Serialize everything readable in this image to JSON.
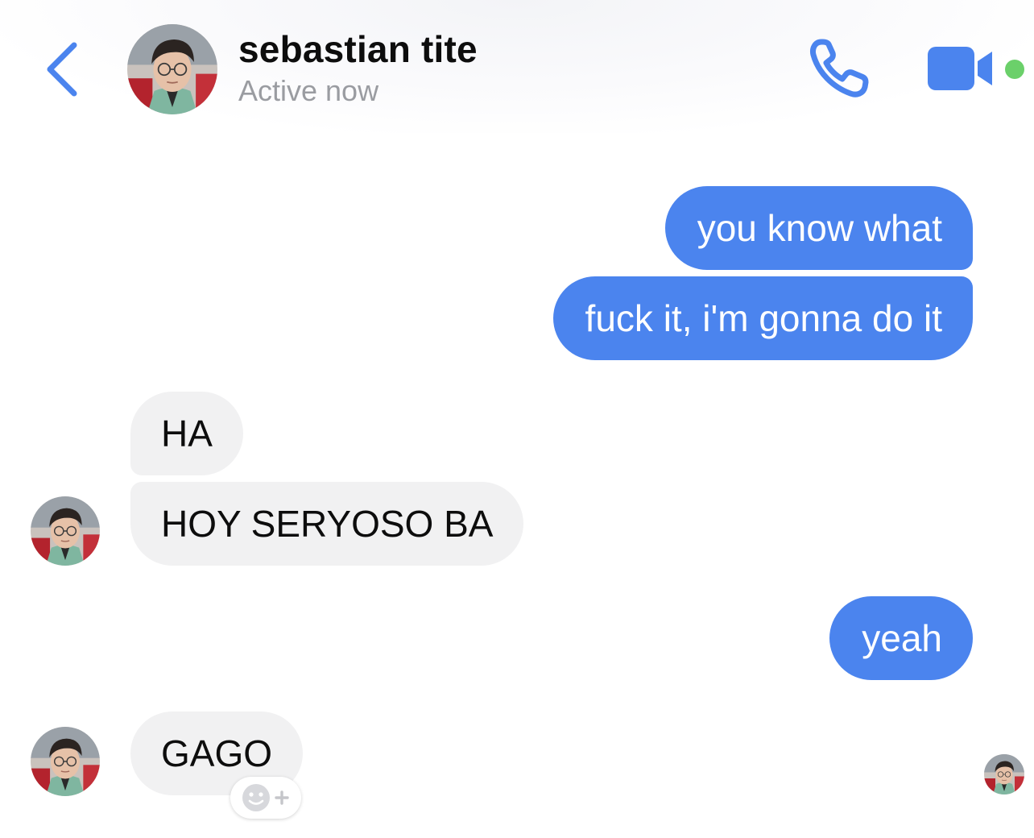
{
  "header": {
    "name": "sebastian tite",
    "status": "Active now",
    "back_icon": "chevron-left-icon",
    "call_icon": "phone-icon",
    "video_icon": "video-camera-icon",
    "online_indicator_color": "#6bd06a"
  },
  "colors": {
    "accent": "#4b84ee",
    "incoming_bubble": "#f1f1f2",
    "status_text": "#9a9ca1"
  },
  "messages": [
    {
      "from": "me",
      "text": "you know what"
    },
    {
      "from": "me",
      "text": "fuck it, i'm gonna do it"
    },
    {
      "from": "them",
      "text": "HA"
    },
    {
      "from": "them",
      "text": "HOY SERYOSO BA"
    },
    {
      "from": "me",
      "text": "yeah"
    },
    {
      "from": "them",
      "text": "GAGO"
    }
  ],
  "reaction_button": {
    "icon": "add-reaction-icon"
  },
  "read_receipt": {
    "icon": "seen-avatar"
  }
}
